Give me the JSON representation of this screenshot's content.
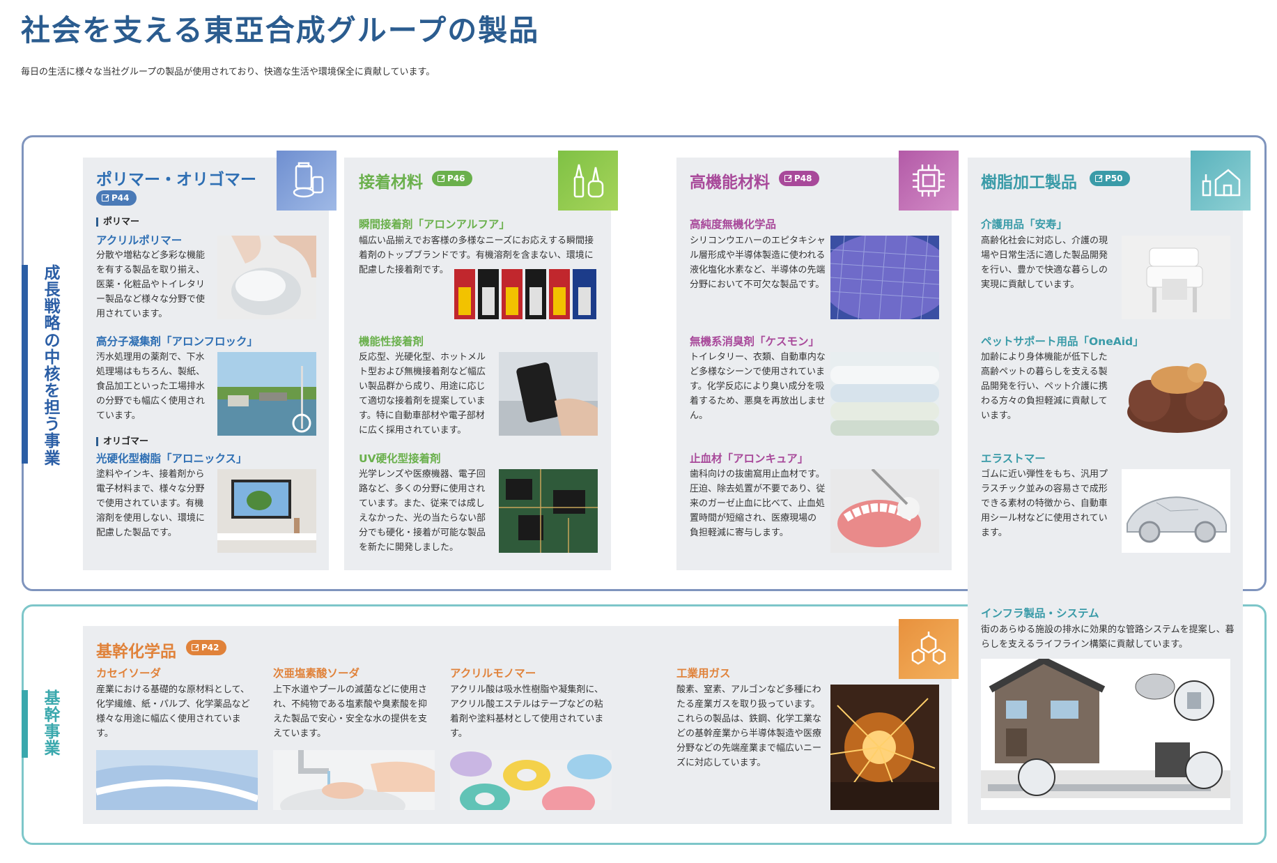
{
  "page": {
    "title": "社会を支える東亞合成グループの製品",
    "subtitle": "毎日の生活に様々な当社グループの製品が使用されており、快適な生活や環境保全に貢献しています。"
  },
  "sections": {
    "growth": {
      "label": "成長戦略の中核を担う事業",
      "color": "#2b5ea5"
    },
    "core": {
      "label": "基幹事業",
      "color": "#3aa8ad"
    }
  },
  "categories": {
    "polymer": {
      "title": "ポリマー・オリゴマー",
      "page": "P44",
      "color": "#2d6eb3",
      "icon": "cosmetics-icon",
      "sub_polymer": "ポリマー",
      "sub_oligomer": "オリゴマー",
      "items": [
        {
          "title": "アクリルポリマー",
          "desc": "分散や増粘など多彩な機能を有する製品を取り揃え、医薬・化粧品やトイレタリー製品など様々な分野で使用されています。"
        },
        {
          "title": "高分子凝集剤「アロンフロック」",
          "desc": "汚水処理用の薬剤で、下水処理場はもちろん、製紙、食品加工といった工場排水の分野でも幅広く使用されています。"
        },
        {
          "title": "光硬化型樹脂「アロニックス」",
          "desc": "塗料やインキ、接着剤から電子材料まで、様々な分野で使用されています。有機溶剤を使用しない、環境に配慮した製品です。"
        }
      ]
    },
    "adhesive": {
      "title": "接着材料",
      "page": "P46",
      "color": "#6ab04c",
      "icon": "glue-tube-icon",
      "items": [
        {
          "title": "瞬間接着剤「アロンアルフア」",
          "desc": "幅広い品揃えでお客様の多様なニーズにお応えする瞬間接着剤のトップブランドです。有機溶剤を含まない、環境に配慮した接着剤です。"
        },
        {
          "title": "機能性接着剤",
          "desc": "反応型、光硬化型、ホットメルト型および無機接着剤など幅広い製品群から成り、用途に応じて適切な接着剤を提案しています。特に自動車部材や電子部材に広く採用されています。"
        },
        {
          "title": "UV硬化型接着剤",
          "desc": "光学レンズや医療機器、電子回路など、多くの分野に使用されています。また、従来では成しえなかった、光の当たらない部分でも硬化・接着が可能な製品を新たに開発しました。"
        }
      ]
    },
    "functional": {
      "title": "高機能材料",
      "page": "P48",
      "color": "#a8499a",
      "icon": "chip-icon",
      "items": [
        {
          "title": "高純度無機化学品",
          "desc": "シリコンウエハーのエピタキシャル層形成や半導体製造に使われる液化塩化水素など、半導体の先端分野において不可欠な製品です。"
        },
        {
          "title": "無機系消臭剤「ケスモン」",
          "desc": "トイレタリー、衣類、自動車内など多様なシーンで使用されています。化学反応により臭い成分を吸着するため、悪臭を再放出しません。"
        },
        {
          "title": "止血材「アロンキュア」",
          "desc": "歯科向けの抜歯窩用止血材です。圧迫、除去処置が不要であり、従来のガーゼ止血に比べて、止血処置時間が短縮され、医療現場の負担軽減に寄与します。"
        }
      ]
    },
    "resin": {
      "title": "樹脂加工製品",
      "page": "P50",
      "color": "#3a9ba8",
      "icon": "house-icon",
      "items": [
        {
          "title": "介護用品「安寿」",
          "desc": "高齢化社会に対応し、介護の現場や日常生活に適した製品開発を行い、豊かで快適な暮らしの実現に貢献しています。"
        },
        {
          "title": "ペットサポート用品「OneAid」",
          "desc": "加齢により身体機能が低下した高齢ペットの暮らしを支える製品開発を行い、ペット介護に携わる方々の負担軽減に貢献しています。"
        },
        {
          "title": "エラストマー",
          "desc": "ゴムに近い弾性をもち、汎用プラスチック並みの容易さで成形できる素材の特徴から、自動車用シール材などに使用されています。"
        },
        {
          "title": "インフラ製品・システム",
          "desc": "街のあらゆる施設の排水に効果的な管路システムを提案し、暮らしを支えるライフライン構築に貢献しています。"
        }
      ]
    },
    "basic": {
      "title": "基幹化学品",
      "page": "P42",
      "color": "#e0823a",
      "icon": "molecule-icon",
      "items": [
        {
          "title": "カセイソーダ",
          "desc": "産業における基礎的な原材料として、化学繊維、紙・パルプ、化学薬品など様々な用途に幅広く使用されています。"
        },
        {
          "title": "次亜塩素酸ソーダ",
          "desc": "上下水道やプールの滅菌などに使用され、不純物である塩素酸や臭素酸を抑えた製品で安心・安全な水の提供を支えています。"
        },
        {
          "title": "アクリルモノマー",
          "desc": "アクリル酸は吸水性樹脂や凝集剤に、アクリル酸エステルはテープなどの粘着剤や塗料基材として使用されています。"
        },
        {
          "title": "工業用ガス",
          "desc": "酸素、窒素、アルゴンなど多種にわたる産業ガスを取り扱っています。これらの製品は、鉄鋼、化学工業などの基幹産業から半導体製造や医療分野などの先端産業まで幅広いニーズに対応しています。"
        }
      ]
    }
  }
}
